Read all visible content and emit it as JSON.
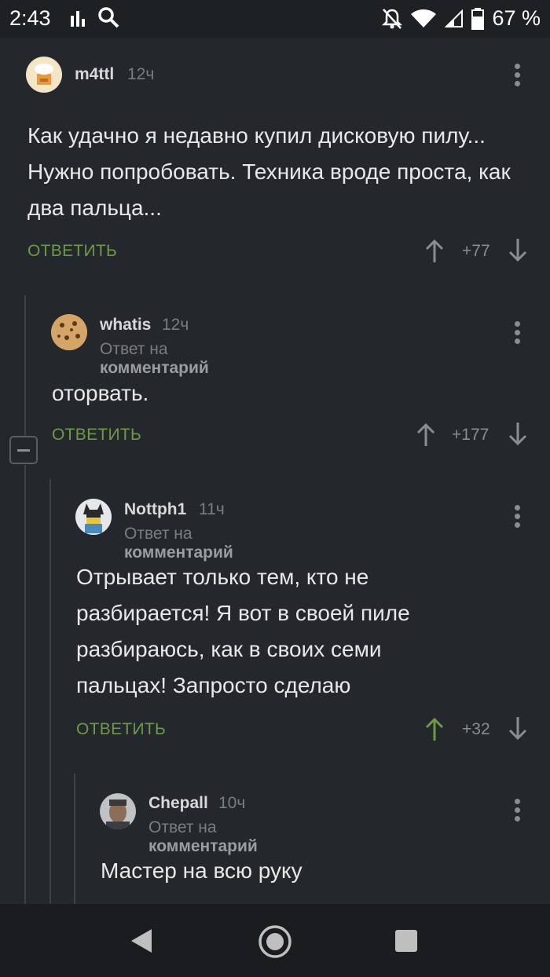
{
  "status_bar": {
    "time": "2:43",
    "battery": "67 %"
  },
  "comments": [
    {
      "username": "m4ttl",
      "time": "12ч",
      "reply_to": null,
      "body": "Как удачно я недавно купил дисковую пилу... Нужно попробовать. Техника вроде проста, как два пальца...",
      "reply_label": "ОТВЕТИТЬ",
      "score": "+77",
      "vote": "none"
    },
    {
      "username": "whatis",
      "time": "12ч",
      "reply_to_prefix": "Ответ на",
      "reply_to": "комментарий",
      "body": "оторвать.",
      "reply_label": "ОТВЕТИТЬ",
      "score": "+177",
      "vote": "none"
    },
    {
      "username": "Nottph1",
      "time": "11ч",
      "reply_to_prefix": "Ответ на",
      "reply_to": "комментарий",
      "body": "Отрывает только тем, кто не разбирается! Я вот в своей пиле разбираюсь, как в своих семи пальцах! Запросто сделаю",
      "reply_label": "ОТВЕТИТЬ",
      "score": "+32",
      "vote": "up"
    },
    {
      "username": "Chepall",
      "time": "10ч",
      "reply_to_prefix": "Ответ на",
      "reply_to": "комментарий",
      "body": "Мастер на всю руку"
    }
  ],
  "colors": {
    "accent_green": "#6e9a47",
    "background": "#24272b"
  },
  "icons": [
    "signal-bars-icon",
    "search-icon",
    "mute-bell-icon",
    "wifi-icon",
    "cell-signal-icon",
    "battery-icon",
    "upvote-arrow-icon",
    "downvote-arrow-icon",
    "more-vert-icon",
    "collapse-thread-icon",
    "nav-back-icon",
    "nav-home-icon",
    "nav-recents-icon"
  ]
}
